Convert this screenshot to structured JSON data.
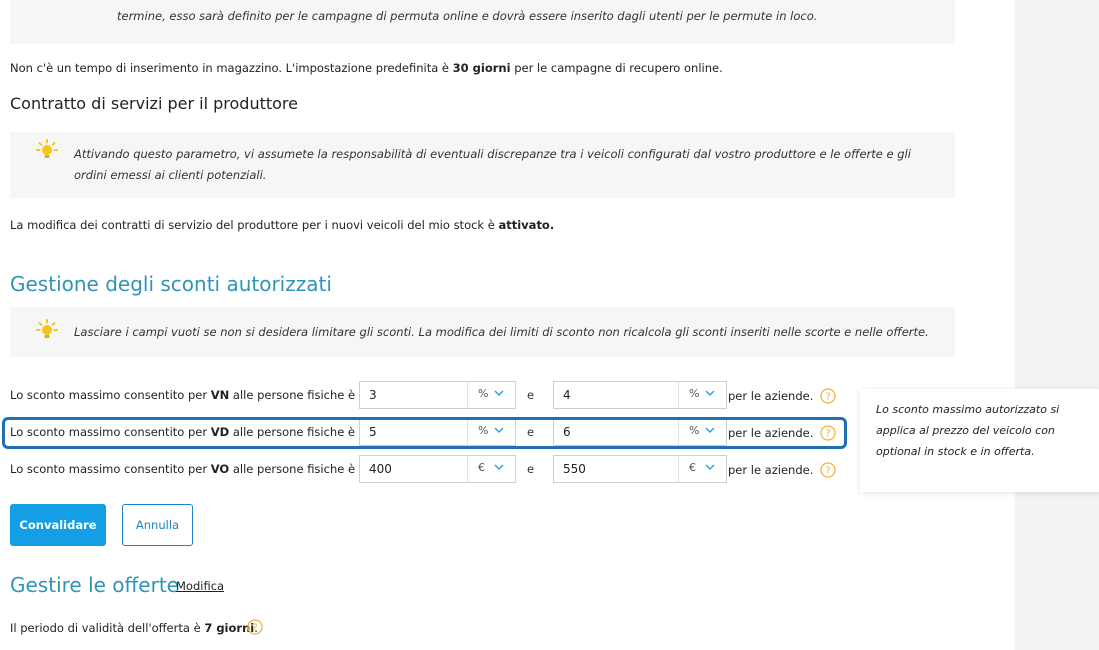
{
  "top_note": {
    "text": "termine, esso sarà definito per le campagne di permuta online e dovrà essere inserito dagli utenti per le permute in loco."
  },
  "stock_time": {
    "prefix": "Non c'è un tempo di inserimento in magazzino. L'impostazione predefinita è ",
    "bold": "30 giorni",
    "suffix": " per le campagne di recupero online."
  },
  "producer_contract": {
    "title": "Contratto di servizi per il produttore",
    "note": "Attivando questo parametro, vi assumete la responsabilità di eventuali discrepanze tra i veicoli configurati dal vostro produttore e le offerte e gli ordini emessi ai clienti potenziali.",
    "status_prefix": "La modifica dei contratti di servizio del produttore per i nuovi veicoli del mio stock è ",
    "status_bold": "attivato."
  },
  "discounts": {
    "title": "Gestione degli sconti autorizzati",
    "note": "Lasciare i campi vuoti se non si desidera limitare gli sconti. La modifica dei limiti di sconto non ricalcola gli sconti inseriti nelle scorte e nelle offerte.",
    "label_prefix": "Lo sconto massimo consentito per ",
    "label_suffix": " alle persone fisiche è",
    "and": "e",
    "tail": "per le aziende.",
    "rows": [
      {
        "type": "VN",
        "individual_value": "3",
        "individual_unit": "%",
        "company_value": "4",
        "company_unit": "%"
      },
      {
        "type": "VD",
        "individual_value": "5",
        "individual_unit": "%",
        "company_value": "6",
        "company_unit": "%"
      },
      {
        "type": "VO",
        "individual_value": "400",
        "individual_unit": "€",
        "company_value": "550",
        "company_unit": "€"
      }
    ],
    "tooltip": "Lo sconto massimo autorizzato si applica al prezzo del veicolo con optional in stock e in offerta."
  },
  "buttons": {
    "validate": "Convalidare",
    "cancel": "Annulla"
  },
  "offers": {
    "title": "Gestire le offerte",
    "edit_link": "Modifica",
    "validity_prefix": "Il periodo di validità dell'offerta è ",
    "validity_bold": "7 giorni",
    "validity_suffix": "."
  },
  "colors": {
    "accent_blue": "#2f95b8",
    "primary_button": "#149ee6",
    "highlight_border": "#1f6fb5",
    "help_icon": "#f5b335"
  },
  "icons": [
    "lightbulb-icon",
    "chevron-down-icon",
    "help-icon"
  ]
}
